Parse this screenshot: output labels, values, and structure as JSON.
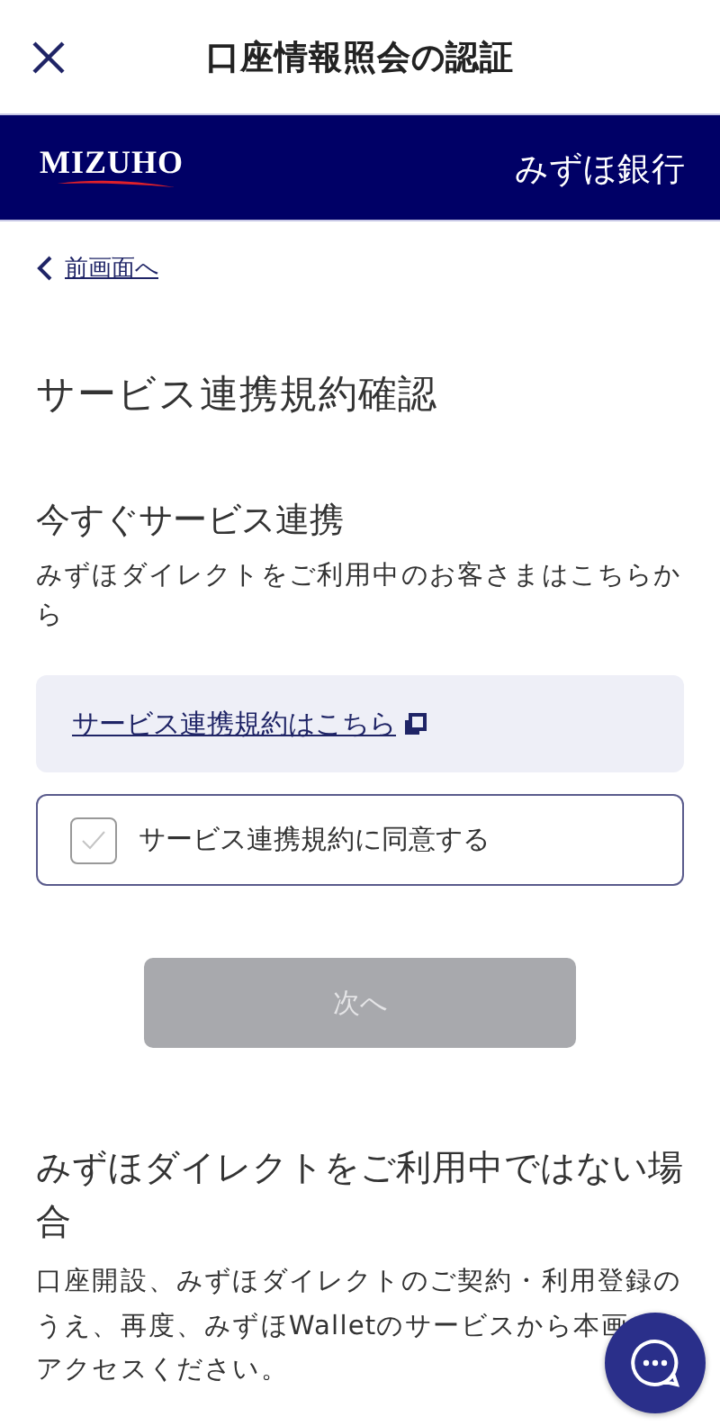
{
  "header": {
    "title": "口座情報照会の認証"
  },
  "brand": {
    "logo": "MIZUHO",
    "bank_name": "みずほ銀行"
  },
  "back_link": "前画面へ",
  "page_title": "サービス連携規約確認",
  "section_connect": {
    "heading": "今すぐサービス連携",
    "text": "みずほダイレクトをご利用中のお客さまはこちらから",
    "terms_link": "サービス連携規約はこちら",
    "agree": {
      "label": "サービス連携規約に同意する",
      "checked": false
    },
    "next_button": {
      "label": "次へ",
      "disabled": true
    }
  },
  "section_other": {
    "heading": "みずほダイレクトをご利用中ではない場合",
    "lines": [
      "口座開設、みずほダイレクトのご契約・利用登録の",
      "うえ、再度、みずほWalletのサービスから本画",
      "アクセスください。"
    ]
  }
}
